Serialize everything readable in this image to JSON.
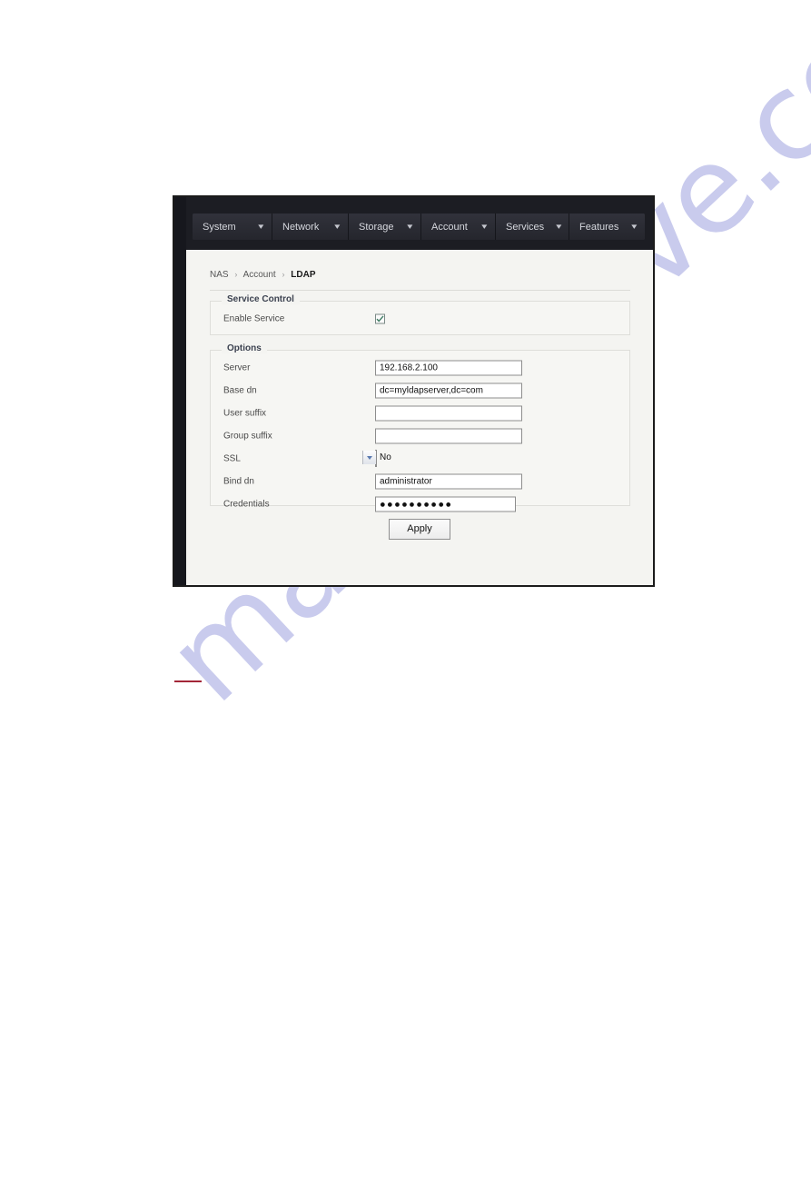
{
  "watermark": {
    "text": "manualshive.com"
  },
  "nav": {
    "tabs": [
      {
        "label": "System",
        "icon": "chevron-down-icon",
        "caret": "▾"
      },
      {
        "label": "Network",
        "icon": "chevron-down-icon",
        "caret": "▾"
      },
      {
        "label": "Storage",
        "icon": "chevron-down-icon",
        "caret": "▾"
      },
      {
        "label": "Account",
        "icon": "chevron-down-icon",
        "caret": "▾"
      },
      {
        "label": "Services",
        "icon": "chevron-down-icon",
        "caret": "▾"
      },
      {
        "label": "Features",
        "icon": "chevron-down-icon",
        "caret": "▾"
      }
    ]
  },
  "breadcrumb": {
    "root": "NAS",
    "separator": "›",
    "section": "Account",
    "current": "LDAP"
  },
  "service_control": {
    "legend": "Service Control",
    "enable_service": {
      "label": "Enable Service",
      "checked": true
    }
  },
  "options": {
    "legend": "Options",
    "fields": [
      {
        "label": "Server",
        "type": "text",
        "value": "192.168.2.100"
      },
      {
        "label": "Base dn",
        "type": "text",
        "value": "dc=myldapserver,dc=com"
      },
      {
        "label": "User suffix",
        "type": "text",
        "value": ""
      },
      {
        "label": "Group suffix",
        "type": "text",
        "value": ""
      },
      {
        "label": "SSL",
        "type": "select",
        "value": "No"
      },
      {
        "label": "Bind dn",
        "type": "text",
        "value": "administrator"
      },
      {
        "label": "Credentials",
        "type": "password",
        "value": "●●●●●●●●●●"
      }
    ]
  },
  "actions": {
    "apply_label": "Apply"
  },
  "colors": {
    "nav_bg": "#1c1d23",
    "tab_bg": "#2a2b33",
    "page_bg": "#f4f4f1",
    "legend_text": "#3c4250",
    "checkbox_check": "#3f7d63",
    "select_arrow": "#5b7ab0",
    "red_rule": "#a32638",
    "watermark": "#c9cbed"
  }
}
